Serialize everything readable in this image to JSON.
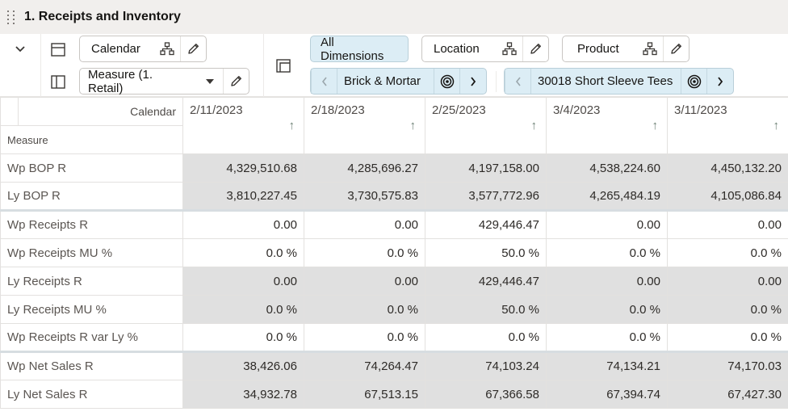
{
  "header": {
    "title": "1. Receipts and Inventory"
  },
  "toolbar": {
    "row_dimension": {
      "label": "Calendar"
    },
    "measure_dimension": {
      "label": "Measure (1. Retail)"
    },
    "all_dimensions_label": "All Dimensions",
    "location": {
      "label": "Location",
      "current": "Brick & Mortar"
    },
    "product": {
      "label": "Product",
      "current": "30018 Short Sleeve Tees"
    }
  },
  "grid": {
    "corner": {
      "column_axis": "Calendar",
      "row_axis": "Measure"
    },
    "columns": [
      "2/11/2023",
      "2/18/2023",
      "2/25/2023",
      "3/4/2023",
      "3/11/2023"
    ],
    "rows": [
      {
        "label": "Wp BOP R",
        "shaded": true,
        "values": [
          "4,329,510.68",
          "4,285,696.27",
          "4,197,158.00",
          "4,538,224.60",
          "4,450,132.20"
        ]
      },
      {
        "label": "Ly BOP R",
        "shaded": true,
        "values": [
          "3,810,227.45",
          "3,730,575.83",
          "3,577,772.96",
          "4,265,484.19",
          "4,105,086.84"
        ]
      },
      {
        "label": "Wp Receipts R",
        "shaded": false,
        "group_start": true,
        "values": [
          "0.00",
          "0.00",
          "429,446.47",
          "0.00",
          "0.00"
        ]
      },
      {
        "label": "Wp Receipts MU %",
        "shaded": false,
        "values": [
          "0.0 %",
          "0.0 %",
          "50.0 %",
          "0.0 %",
          "0.0 %"
        ]
      },
      {
        "label": "Ly Receipts R",
        "shaded": true,
        "values": [
          "0.00",
          "0.00",
          "429,446.47",
          "0.00",
          "0.00"
        ]
      },
      {
        "label": "Ly Receipts MU %",
        "shaded": true,
        "values": [
          "0.0 %",
          "0.0 %",
          "50.0 %",
          "0.0 %",
          "0.0 %"
        ]
      },
      {
        "label": "Wp Receipts R var Ly %",
        "shaded": false,
        "values": [
          "0.0 %",
          "0.0 %",
          "0.0 %",
          "0.0 %",
          "0.0 %"
        ]
      },
      {
        "label": "Wp Net Sales R",
        "shaded": true,
        "group_start": true,
        "values": [
          "38,426.06",
          "74,264.47",
          "74,103.24",
          "74,134.21",
          "74,170.03"
        ]
      },
      {
        "label": "Ly Net Sales R",
        "shaded": true,
        "values": [
          "34,932.78",
          "67,513.15",
          "67,366.58",
          "67,394.74",
          "67,427.30"
        ]
      }
    ]
  }
}
